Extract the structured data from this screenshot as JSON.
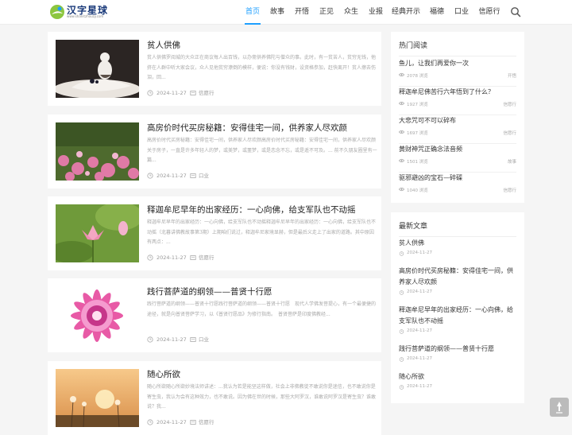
{
  "header": {
    "logo_text": "汉字星球",
    "logo_sub": "www.shanitzhouzy.com",
    "nav": [
      "首页",
      "故事",
      "开悟",
      "正见",
      "众生",
      "业报",
      "经典开示",
      "福德",
      "口业",
      "信愿行"
    ],
    "active_nav": 0
  },
  "articles": [
    {
      "title": "贫人供佛",
      "excerpt": "贫人供佛罗阅城的大众正在商议每人出百钱，以办斋供养佛陀与僧众的事。此时，有一贫苦人，贫穷无钱，他挤在人群中听大家会议，众人见他贫穷潦倒的模样，便说：你没有钱财，设资格参加，赶快离开！贫人擦去伤泪，回...",
      "date": "2024-11-27",
      "category": "信愿行"
    },
    {
      "title": "高房价时代买房秘籍：安得佳宅一间，供养家人尽欢颜",
      "excerpt": "高房价时代买房秘籍：安得佳宅一间，供养家人尽欢颜高房价时代买房秘籍：安得佳宅一间，供养家人尽欢颜 关于房子，一直是许多年轻人的梦，或美梦，或噩梦，或是恋念不忘，或是遥不可及。... 前不久朋友圈里有一篇...",
      "date": "2024-11-27",
      "category": "口业"
    },
    {
      "title": "释迦牟尼早年的出家经历：一心向佛，给支军队也不动摇",
      "excerpt": "释迦牟尼早年的出家经历：一心向佛，给支军队也不动摇释迦牟尼早年的出家经历：一心向佛，给支军队也不动摇（北暮讲佛教故事第3期）上期咱们说过，释迦牟尼家境显赫，但是最后义走上了出家的道路。其中原因有两点：...",
      "date": "2024-11-27",
      "category": "信愿行"
    },
    {
      "title": "践行菩萨道的纲领——普贤十行愿",
      "excerpt": "践行菩萨道的纲领——普贤十行愿践行菩萨道的纲领——普贤十行愿　现代人学佛发菩提心，有一个最便捷的途径，就是向普贤菩萨学习，以《普贤行愿品》为修行指南。　普贤菩萨是印度佛教经...",
      "date": "2024-11-27",
      "category": "口业"
    },
    {
      "title": "随心所欲",
      "excerpt": "随心所欲随心所欲妙境法师讲述：...我认为若是能坚这样做，社会上非佛教徒不敢说你是迷信，也不敢说你是寄生虫，我认为会有这种效力，也不敢说。因为佛在世的时候，那些大阿罗汉，谁敢说阿罗汉是寄生虫？谁敢说？我...",
      "date": "2024-11-27",
      "category": "信愿行"
    }
  ],
  "sidebar": {
    "hot_title": "热门阅读",
    "views_suffix": "浏览",
    "hot": [
      {
        "title": "鱼儿，让我们再爱你一次",
        "views": "2078",
        "category": "开悟"
      },
      {
        "title": "释迦牟尼佛苦行六年悟到了什么？",
        "views": "1927",
        "category": "信愿行"
      },
      {
        "title": "大悲咒可不可以碎布",
        "views": "1697",
        "category": "信愿行"
      },
      {
        "title": "黄财神咒正确念法音频",
        "views": "1501",
        "category": "故事"
      },
      {
        "title": "驱邪避凶的宝石—碎磲",
        "views": "1040",
        "category": "信愿行"
      }
    ],
    "new_title": "最新文章",
    "recent": [
      {
        "title": "贫人供佛",
        "date": "2024-11-27"
      },
      {
        "title": "高房价时代买房秘籍：安得佳宅一间，供养家人尽欢颜",
        "date": "2024-11-27"
      },
      {
        "title": "释迦牟尼早年的出家经历：一心向佛，给支军队也不动摇",
        "date": "2024-11-27"
      },
      {
        "title": "践行菩萨道的纲领——普贤十行愿",
        "date": "2024-11-27"
      },
      {
        "title": "随心所欲",
        "date": "2024-11-27"
      }
    ]
  },
  "icons": {
    "search": "search-icon",
    "clock": "clock-icon",
    "folder": "folder-icon",
    "eye": "eye-icon",
    "top": "back-to-top-icon"
  },
  "colors": {
    "accent": "#1e9fff",
    "background": "#f5f5f5"
  }
}
